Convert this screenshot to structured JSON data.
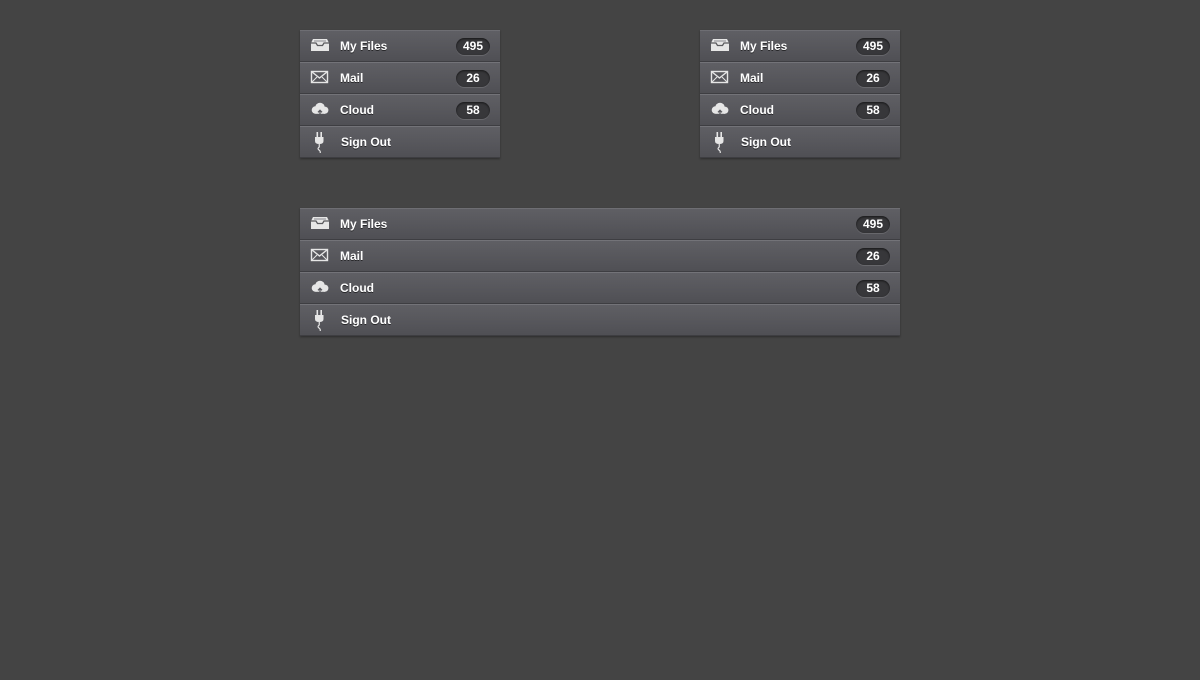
{
  "colors": {
    "page_background": "#444444",
    "item_gradient_top": "#5f5f64",
    "item_gradient_bottom": "#4f4f54",
    "badge_background": "#37373a",
    "text": "#ffffff"
  },
  "menus": [
    {
      "items": [
        {
          "icon": "inbox-tray-icon",
          "label": "My Files",
          "count": "495"
        },
        {
          "icon": "envelope-icon",
          "label": "Mail",
          "count": "26"
        },
        {
          "icon": "cloud-icon",
          "label": "Cloud",
          "count": "58"
        },
        {
          "icon": "power-plug-icon",
          "label": "Sign Out"
        }
      ]
    },
    {
      "items": [
        {
          "icon": "inbox-tray-icon",
          "label": "My Files",
          "count": "495"
        },
        {
          "icon": "envelope-icon",
          "label": "Mail",
          "count": "26"
        },
        {
          "icon": "cloud-icon",
          "label": "Cloud",
          "count": "58"
        },
        {
          "icon": "power-plug-icon",
          "label": "Sign Out"
        }
      ]
    },
    {
      "items": [
        {
          "icon": "inbox-tray-icon",
          "label": "My Files",
          "count": "495"
        },
        {
          "icon": "envelope-icon",
          "label": "Mail",
          "count": "26"
        },
        {
          "icon": "cloud-icon",
          "label": "Cloud",
          "count": "58"
        },
        {
          "icon": "power-plug-icon",
          "label": "Sign Out"
        }
      ]
    }
  ]
}
